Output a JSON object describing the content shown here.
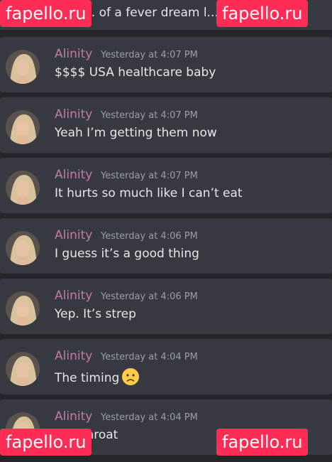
{
  "top_partial_message": "... of a fever dream l...",
  "watermark_text": "fapello.ru",
  "messages": [
    {
      "author": "Alinity",
      "time": "Yesterday at 4:07 PM",
      "text": "$$$$ USA healthcare baby"
    },
    {
      "author": "Alinity",
      "time": "Yesterday at 4:07 PM",
      "text": "Yeah I’m getting them now"
    },
    {
      "author": "Alinity",
      "time": "Yesterday at 4:07 PM",
      "text": "It hurts so much like I can’t eat"
    },
    {
      "author": "Alinity",
      "time": "Yesterday at 4:06 PM",
      "text": "I guess it’s a good thing"
    },
    {
      "author": "Alinity",
      "time": "Yesterday at 4:06 PM",
      "text": "Yep. It’s strep"
    },
    {
      "author": "Alinity",
      "time": "Yesterday at 4:04 PM",
      "text": "The timing",
      "emoji": "worried-face-icon"
    },
    {
      "author": "Alinity",
      "time": "Yesterday at 4:04 PM",
      "text": "... p throat"
    }
  ],
  "colors": {
    "background": "#242629",
    "card": "#36393f",
    "author": "#c27ba8",
    "timestamp": "#9a9ea6",
    "text": "#e6e7e9",
    "watermark_bg": "#ff2d55"
  }
}
